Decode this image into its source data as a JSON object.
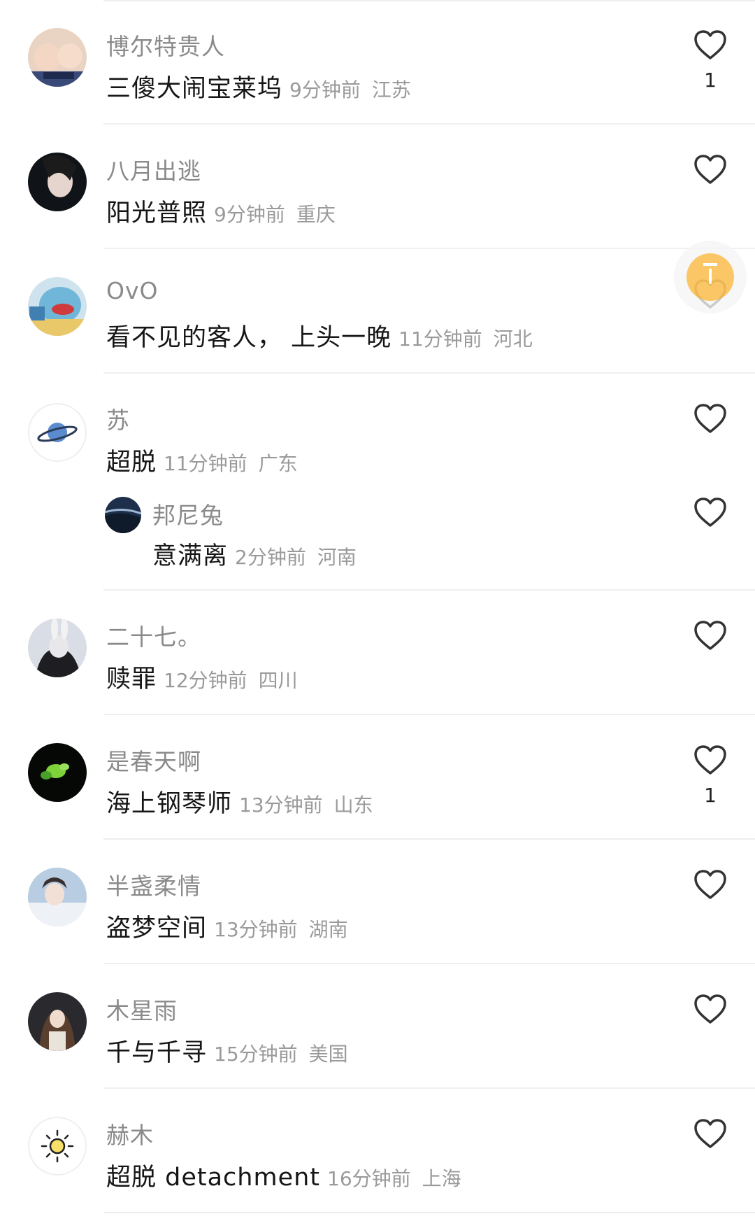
{
  "comments": [
    {
      "username": "博尔特贵人",
      "content": "三傻大闹宝莱坞",
      "time": "9分钟前",
      "region": "江苏",
      "likes": "1"
    },
    {
      "username": "八月出逃",
      "content": "阳光普照",
      "time": "9分钟前",
      "region": "重庆",
      "likes": ""
    },
    {
      "username": "OvO",
      "content": "看不见的客人， 上头一晚",
      "time": "11分钟前",
      "region": "河北",
      "likes": ""
    },
    {
      "username": "苏",
      "content": "超脱",
      "time": "11分钟前",
      "region": "广东",
      "likes": "",
      "reply": {
        "username": "邦尼兔",
        "content": "意满离",
        "time": "2分钟前",
        "region": "河南",
        "likes": ""
      }
    },
    {
      "username": "二十七。",
      "content": "赎罪",
      "time": "12分钟前",
      "region": "四川",
      "likes": ""
    },
    {
      "username": "是春天啊",
      "content": "海上钢琴师",
      "time": "13分钟前",
      "region": "山东",
      "likes": "1"
    },
    {
      "username": "半盏柔情",
      "content": "盗梦空间",
      "time": "13分钟前",
      "region": "湖南",
      "likes": ""
    },
    {
      "username": "木星雨",
      "content": "千与千寻",
      "time": "15分钟前",
      "region": "美国",
      "likes": ""
    },
    {
      "username": "赫木",
      "content": "超脱 detachment",
      "time": "16分钟前",
      "region": "上海",
      "likes": ""
    }
  ],
  "colors": {
    "username": "#8a8a8a",
    "content": "#161616",
    "meta": "#9a9a9a",
    "divider": "#efefef",
    "fab": "#fbc35a"
  },
  "icons": {
    "like": "heart-outline-icon",
    "fab": "back-to-top-icon"
  }
}
